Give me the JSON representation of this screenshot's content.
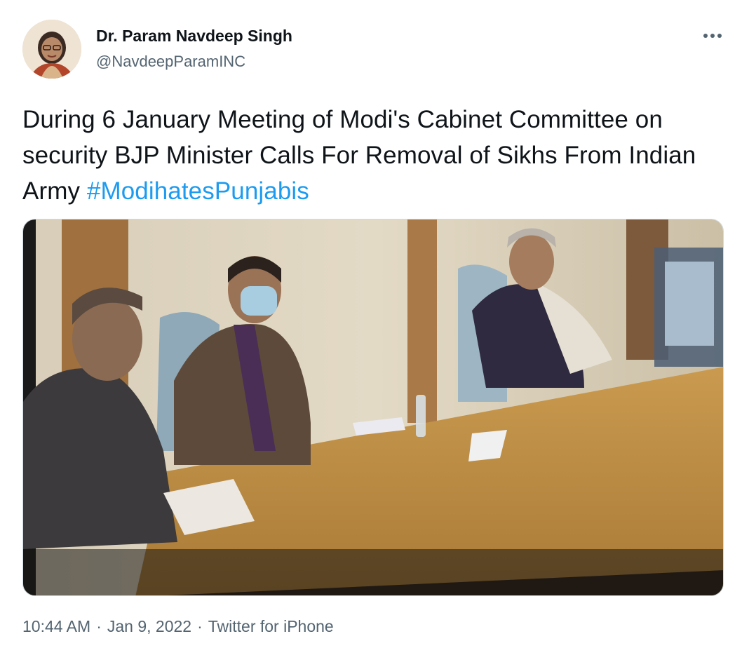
{
  "author": {
    "display_name": "Dr. Param Navdeep Singh",
    "handle": "@NavdeepParamINC"
  },
  "more_icon": "more-horizontal-icon",
  "tweet": {
    "text": "During 6 January Meeting of Modi's Cabinet Committee on security BJP Minister Calls For Removal of Sikhs From Indian Army ",
    "hashtag": "#ModihatesPunjabis"
  },
  "meta": {
    "time": "10:44 AM",
    "date": "Jan 9, 2022",
    "source": "Twitter for iPhone",
    "separator": "·"
  },
  "colors": {
    "link": "#1d9bf0",
    "secondary_text": "#536471",
    "primary_text": "#0f1419"
  }
}
